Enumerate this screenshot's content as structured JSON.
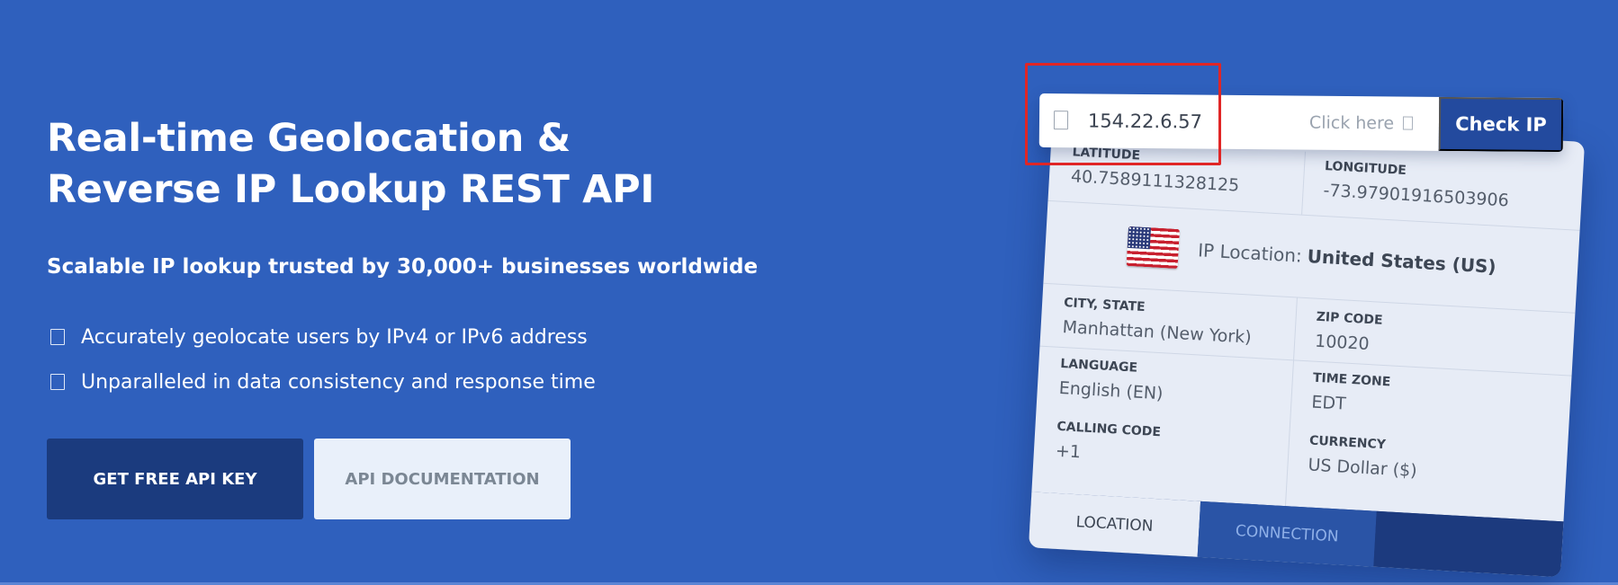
{
  "hero": {
    "title_line1": "Real-time Geolocation &",
    "title_line2": "Reverse IP Lookup REST API",
    "subtitle": "Scalable IP lookup trusted by 30,000+ businesses worldwide",
    "features": [
      "Accurately geolocate users by IPv4 or IPv6 address",
      "Unparalleled in data consistency and response time"
    ],
    "buttons": {
      "primary": "GET FREE API KEY",
      "secondary": "API DOCUMENTATION"
    }
  },
  "search": {
    "ip_value": "154.22.6.57",
    "hint": "Click here",
    "check_button": "Check IP"
  },
  "widget": {
    "latitude": {
      "label": "LATITUDE",
      "value": "40.7589111328125"
    },
    "longitude": {
      "label": "LONGITUDE",
      "value": "-73.97901916503906"
    },
    "location": {
      "label": "IP Location:",
      "country": "United States (US)",
      "flag": "us-flag-icon"
    },
    "city_state": {
      "label": "CITY, STATE",
      "value": "Manhattan (New York)"
    },
    "zip": {
      "label": "ZIP CODE",
      "value": "10020"
    },
    "language": {
      "label": "LANGUAGE",
      "value": "English (EN)"
    },
    "time_zone": {
      "label": "TIME ZONE",
      "value": "EDT"
    },
    "calling_code": {
      "label": "CALLING CODE",
      "value": "+1"
    },
    "currency": {
      "label": "CURRENCY",
      "value": "US Dollar ($)"
    },
    "tabs": [
      "LOCATION",
      "CONNECTION"
    ]
  },
  "colors": {
    "background": "#2f60bd",
    "primary_button": "#1b3b7e",
    "highlight": "#e02626"
  }
}
